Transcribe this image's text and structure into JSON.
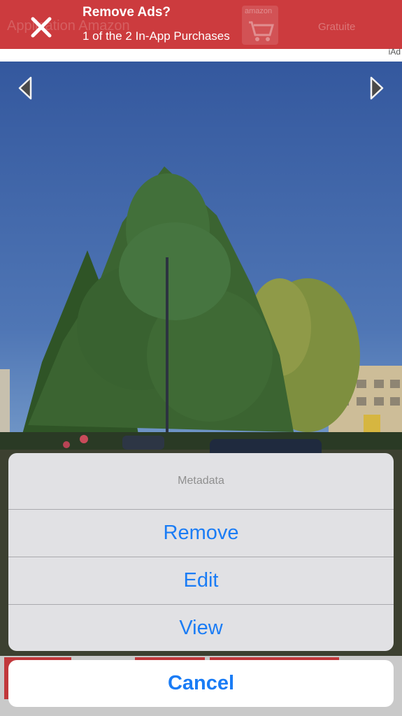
{
  "banner": {
    "title": "Remove Ads?",
    "subtitle": "1 of the 2 In-App Purchases",
    "close_icon": "close-icon",
    "background_color": "#cc3b3e",
    "underlay_text": "Application Amazon",
    "underlay_amazon": "amazon",
    "underlay_gratuite": "Gratuite",
    "ad_label": "iAd"
  },
  "photo": {
    "prev_icon": "chevron-left-icon",
    "next_icon": "chevron-right-icon"
  },
  "action_sheet": {
    "title": "Metadata",
    "buttons": [
      "Remove",
      "Edit",
      "View"
    ],
    "cancel_label": "Cancel",
    "accent_color": "#1a7cf5"
  }
}
